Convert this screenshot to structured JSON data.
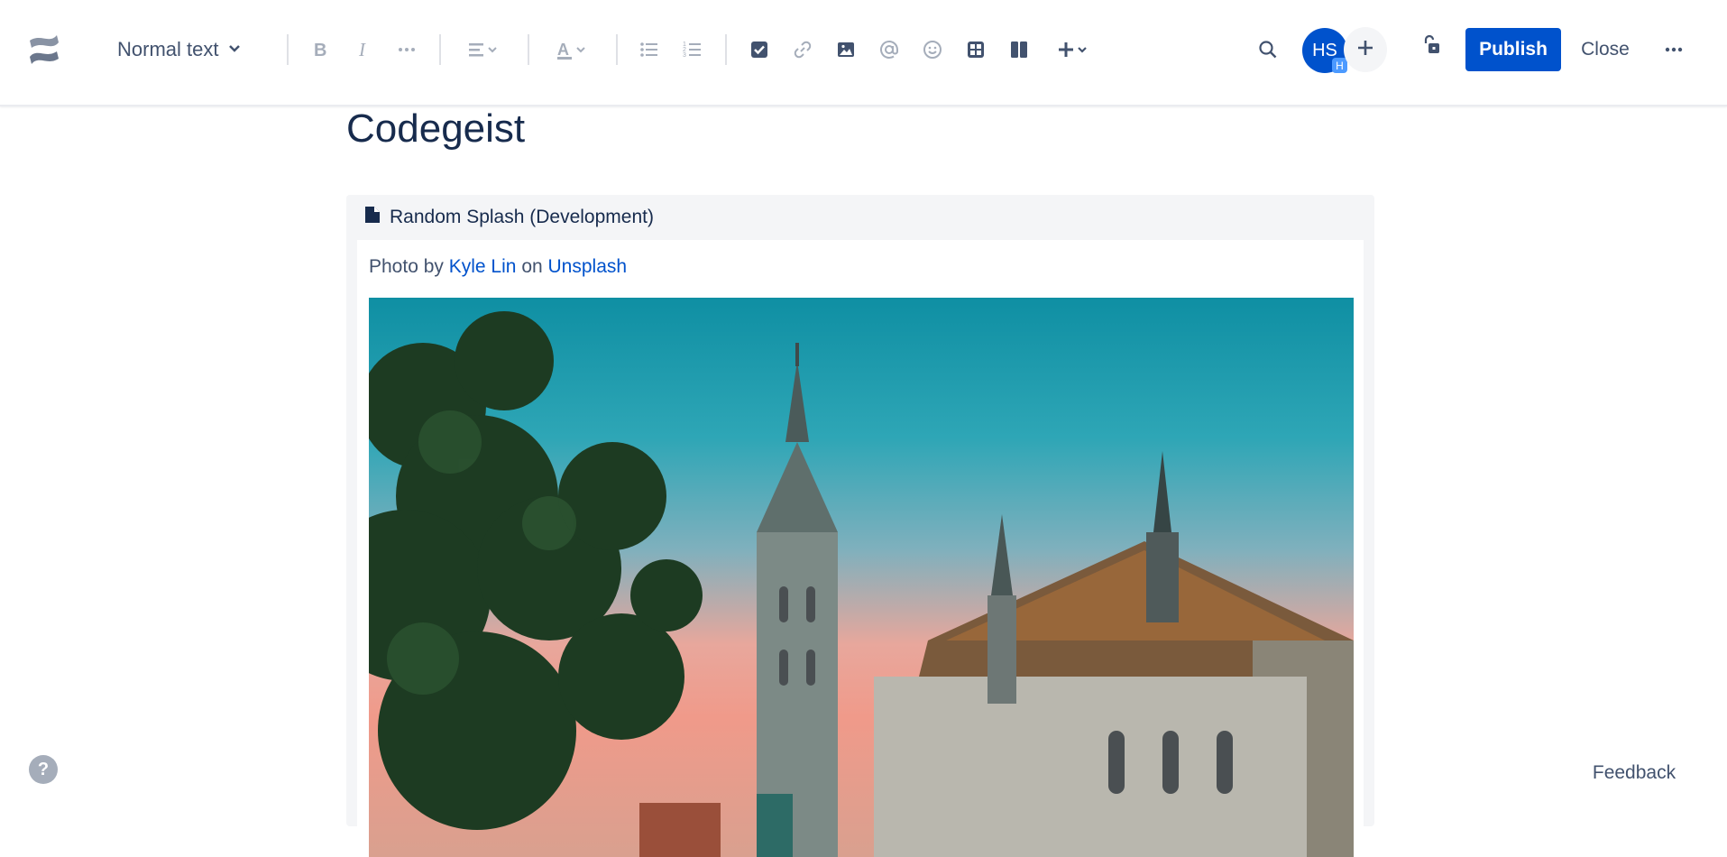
{
  "toolbar": {
    "text_style": "Normal text",
    "publish_label": "Publish",
    "close_label": "Close",
    "avatar_initials": "HS",
    "avatar_badge": "H",
    "icons": [
      "confluence-logo",
      "bold-icon",
      "italic-icon",
      "more-formatting-icon",
      "align-icon",
      "text-color-icon",
      "bullet-list-icon",
      "numbered-list-icon",
      "action-item-icon",
      "link-icon",
      "image-icon",
      "mention-icon",
      "emoji-icon",
      "table-icon",
      "layout-icon",
      "insert-icon",
      "search-icon",
      "unlock-icon",
      "more-icon"
    ]
  },
  "page": {
    "title": "Codegeist"
  },
  "macro": {
    "title": "Random Splash (Development)",
    "credit_prefix": "Photo by",
    "credit_author": "Kyle Lin",
    "credit_mid": "on",
    "credit_source": "Unsplash",
    "image_alt": "Cathedral with colorful tiled roof at sunset"
  },
  "footer": {
    "help_label": "?",
    "feedback_label": "Feedback"
  },
  "colors": {
    "primary": "#0052cc",
    "text": "#172b4d",
    "subtle_text": "#42526e",
    "macro_bg": "#f4f5f7"
  }
}
